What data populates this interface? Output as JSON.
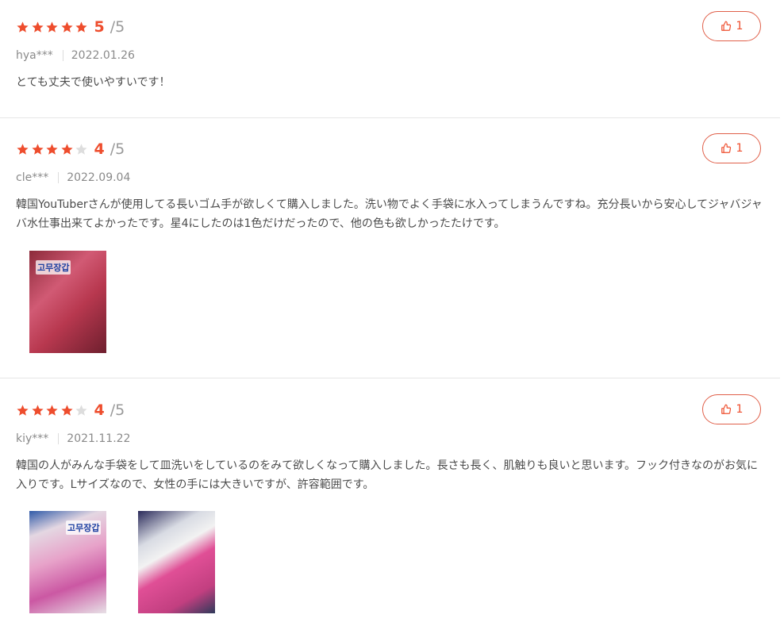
{
  "accent": "#ee4d2d",
  "reviews": [
    {
      "rating": "5",
      "out_of": "/5",
      "stars_filled": 5,
      "user": "hya***",
      "date": "2022.01.26",
      "text": "とても丈夫で使いやすいです！",
      "likes": "1"
    },
    {
      "rating": "4",
      "out_of": "/5",
      "stars_filled": 4,
      "user": "cle***",
      "date": "2022.09.04",
      "text": "韓国YouTuberさんが使用してる長いゴム手が欲しくて購入しました。洗い物でよく手袋に水入ってしまうんですね。充分長いから安心してジャバジャバ水仕事出来てよかったです。星4にしたのは1色だけだったので、他の色も欲しかったたけです。",
      "likes": "1",
      "image_label": "고무장갑"
    },
    {
      "rating": "4",
      "out_of": "/5",
      "stars_filled": 4,
      "user": "kiy***",
      "date": "2021.11.22",
      "text": "韓国の人がみんな手袋をして皿洗いをしているのをみて欲しくなって購入しました。長さも長く、肌触りも良いと思います。フック付きなのがお気に入りです。Lサイズなので、女性の手には大きいですが、許容範囲です。",
      "likes": "1",
      "image_label": "고무장갑"
    }
  ]
}
